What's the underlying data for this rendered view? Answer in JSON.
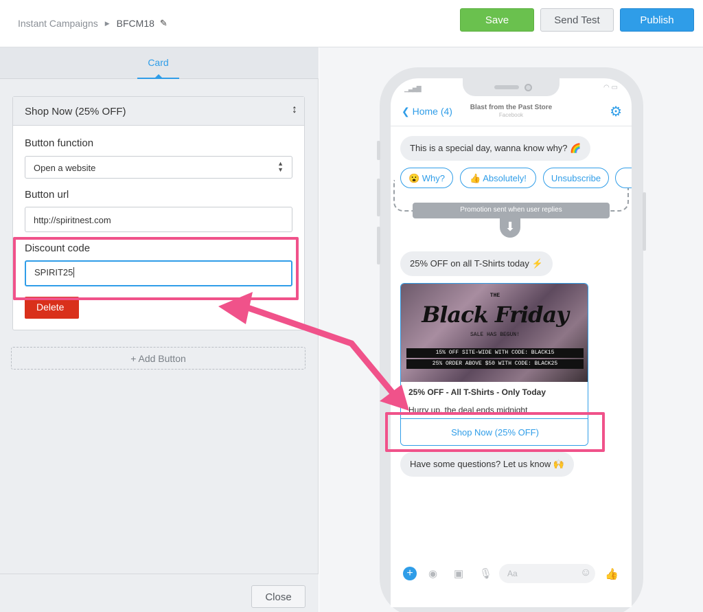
{
  "breadcrumb": {
    "parent": "Instant Campaigns",
    "current": "BFCM18"
  },
  "toolbar": {
    "save_label": "Save",
    "send_test_label": "Send Test",
    "publish_label": "Publish"
  },
  "editor": {
    "tab": "Card",
    "button_card": {
      "title": "Shop Now (25% OFF)",
      "function_label": "Button function",
      "function_value": "Open a website",
      "url_label": "Button url",
      "url_value": "http://spiritnest.com",
      "discount_label": "Discount code",
      "discount_value": "SPIRIT25",
      "delete_label": "Delete"
    },
    "add_button_label": "+ Add Button",
    "close_label": "Close"
  },
  "preview": {
    "back_label": "Home (4)",
    "page_name": "Blast from the Past Store",
    "platform": "Facebook",
    "message1": "This is a special day, wanna know why? 🌈",
    "quick_replies": [
      "😮 Why?",
      "👍 Absolutely!",
      "Unsubscribe"
    ],
    "promo_note": "Promotion sent when user replies",
    "message2": "25% OFF on all T-Shirts today ⚡",
    "card": {
      "image_the": "THE",
      "image_headline": "Black Friday",
      "image_sale": "SALE HAS BEGUN!",
      "image_code1": "15% OFF SITE-WIDE WITH CODE: BLACK15",
      "image_code2": "25% ORDER ABOVE $50 WITH CODE: BLACK25",
      "title": "25% OFF - All T-Shirts - Only Today",
      "subtitle": "Hurry up, the deal ends midnight",
      "button_label": "Shop Now (25% OFF)"
    },
    "message3": "Have some questions? Let us know 🙌",
    "composer_placeholder": "Aa"
  },
  "colors": {
    "accent": "#2f9de8",
    "save": "#6ac14e",
    "delete": "#d9301b",
    "annotation": "#f0528a"
  }
}
